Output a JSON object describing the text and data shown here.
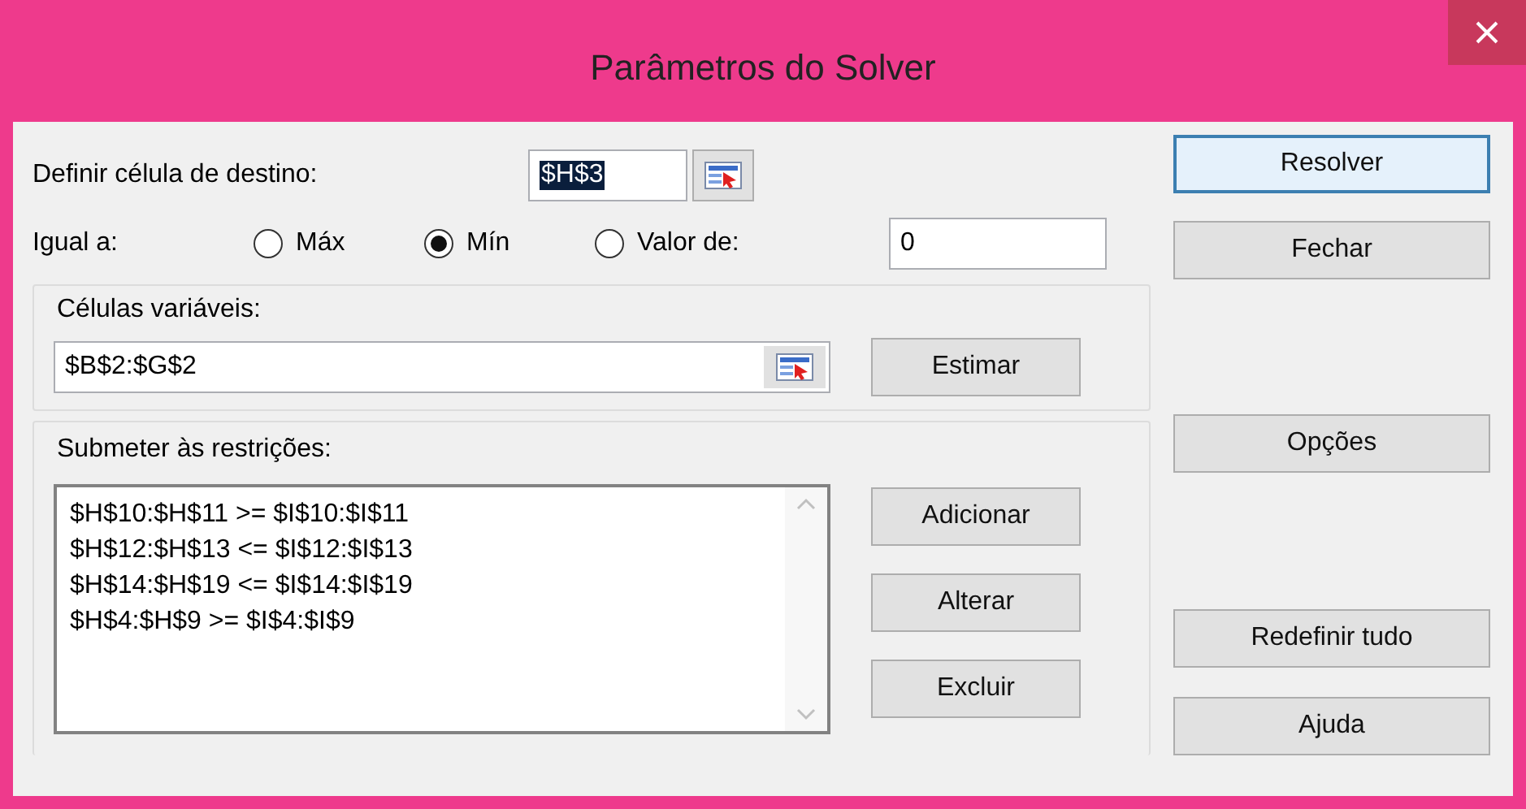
{
  "window": {
    "title": "Parâmetros do Solver"
  },
  "target_cell": {
    "label": "Definir célula de destino:",
    "value": "$H$3",
    "value_selected": true
  },
  "equal_to": {
    "label": "Igual a:",
    "options": [
      {
        "label": "Máx",
        "selected": false
      },
      {
        "label": "Mín",
        "selected": true
      },
      {
        "label": "Valor de:",
        "selected": false
      }
    ],
    "value": "0"
  },
  "variable_cells": {
    "title": "Células variáveis:",
    "value": "$B$2:$G$2",
    "button": "Estimar"
  },
  "constraints": {
    "title": "Submeter às restrições:",
    "items": [
      "$H$10:$H$11 >= $I$10:$I$11",
      "$H$12:$H$13 <= $I$12:$I$13",
      "$H$14:$H$19 <= $I$14:$I$19",
      "$H$4:$H$9 >= $I$4:$I$9"
    ],
    "buttons": [
      "Adicionar",
      "Alterar",
      "Excluir"
    ]
  },
  "side_buttons": [
    {
      "label": "Resolver",
      "default": true
    },
    {
      "label": "Fechar",
      "default": false
    },
    {
      "label": "Opções",
      "default": false
    },
    {
      "label": "Redefinir tudo",
      "default": false
    },
    {
      "label": "Ajuda",
      "default": false
    }
  ]
}
